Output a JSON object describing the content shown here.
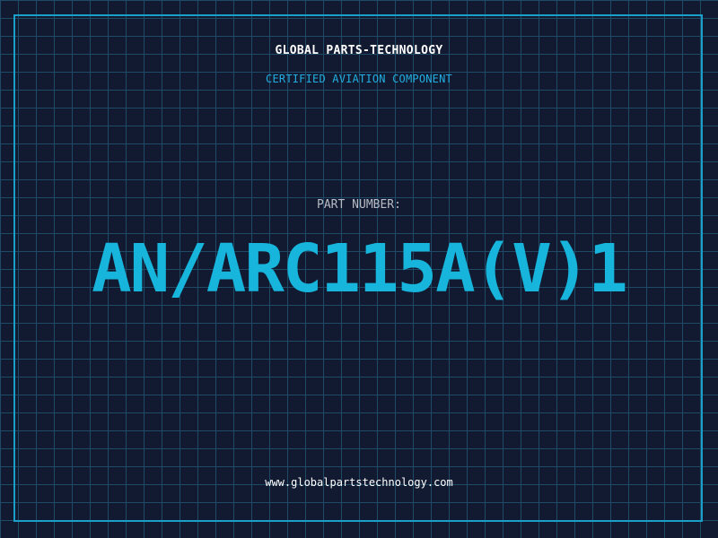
{
  "header": {
    "company": "GLOBAL PARTS-TECHNOLOGY",
    "subtitle": "CERTIFIED AVIATION COMPONENT"
  },
  "part": {
    "label": "PART NUMBER:",
    "number": "AN/ARC115A(V)1"
  },
  "footer": {
    "url": "www.globalpartstechnology.com"
  },
  "colors": {
    "background": "#111a30",
    "grid": "#1f4a66",
    "frame": "#1aa0c8",
    "accent": "#17b4dc"
  }
}
